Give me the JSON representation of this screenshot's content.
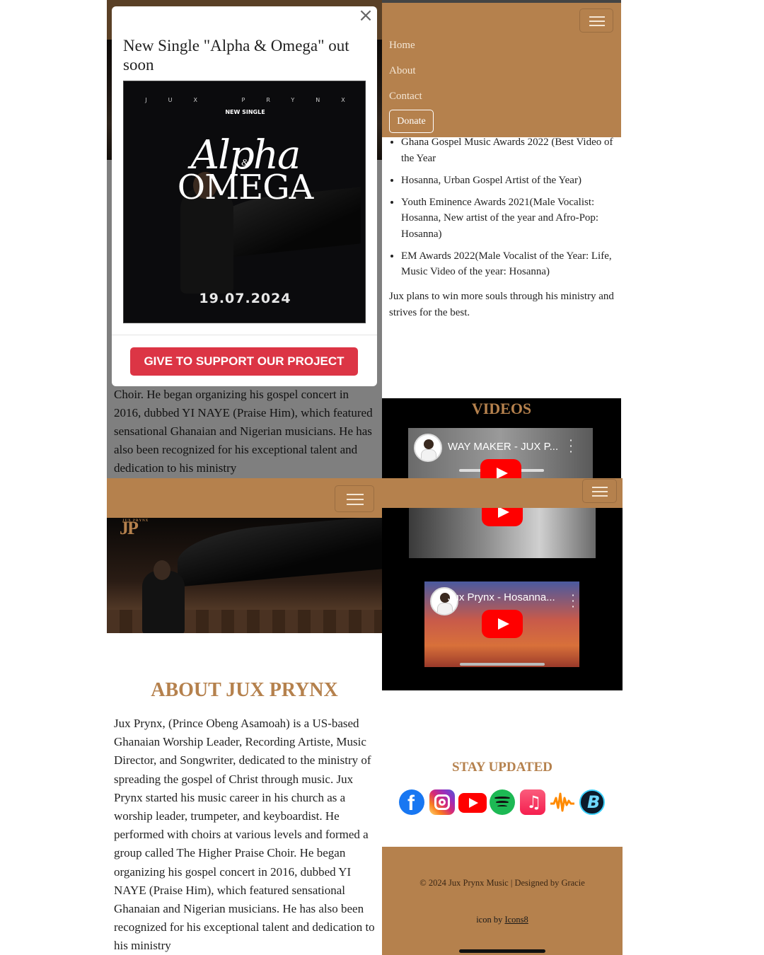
{
  "modal": {
    "title": "New Single \"Alpha & Omega\" out soon",
    "close_symbol": "×",
    "poster": {
      "artist": "JUX PRYNX",
      "subtitle": "NEW SINGLE",
      "title_script": "Alpha",
      "title_amp": "&",
      "title_main": "OMEGA",
      "date": "19.07.2024"
    },
    "cta_label": "GIVE TO SUPPORT OUR PROJECT"
  },
  "background_text": "Choir. He began organizing his gospel concert in 2016, dubbed YI NAYE (Praise Him), which featured sensational Ghanaian and Nigerian musicians. He has also been recognized for his exceptional talent and dedication to his ministry",
  "nav": {
    "links": [
      "Home",
      "About",
      "Contact"
    ],
    "donate_label": "Donate"
  },
  "awards": [
    "Ghana Gospel Music Awards 2022 (Best Video of the Year",
    "Hosanna, Urban Gospel Artist of the Year)",
    "Youth Eminence Awards 2021(Male Vocalist: Hosanna, New artist of the year and Afro-Pop: Hosanna)",
    "EM Awards 2022(Male Vocalist of the Year: Life, Music Video of the year: Hosanna)"
  ],
  "plans_text": "Jux plans to win more souls through his ministry and strives for the best.",
  "videos": {
    "heading": "VIDEOS",
    "items": [
      {
        "title": "WAY MAKER - JUX P..."
      },
      {
        "title": "Jux Prynx - Hosanna..."
      }
    ]
  },
  "hero": {
    "logo": "JP",
    "logo_sub": "JUX PRYNX"
  },
  "about": {
    "heading": "ABOUT JUX PRYNX",
    "text": "Jux Prynx, (Prince Obeng Asamoah) is a US-based Ghanaian Worship Leader, Recording Artiste, Music Director, and Songwriter, dedicated to the ministry of spreading the gospel of Christ through music. Jux Prynx started his music career in his church as a worship leader, trumpeter, and keyboardist. He performed with choirs at various levels and formed a group called The Higher Praise Choir. He began organizing his gospel concert in 2016, dubbed YI NAYE (Praise Him), which featured sensational Ghanaian and Nigerian musicians. He has also been recognized for his exceptional talent and dedication to his ministry"
  },
  "stay_updated": {
    "heading": "STAY UPDATED",
    "icons": [
      "facebook-icon",
      "instagram-icon",
      "youtube-icon",
      "spotify-icon",
      "apple-music-icon",
      "audiomack-icon",
      "boomplay-icon"
    ]
  },
  "footer": {
    "copyright": "© 2024 Jux Prynx Music | Designed by Gracie",
    "icon_by_prefix": "icon by",
    "icon_by_link": "Icons8"
  },
  "colors": {
    "brand": "#b5814d",
    "cta": "#dc3545",
    "youtube_red": "#ff0000"
  }
}
